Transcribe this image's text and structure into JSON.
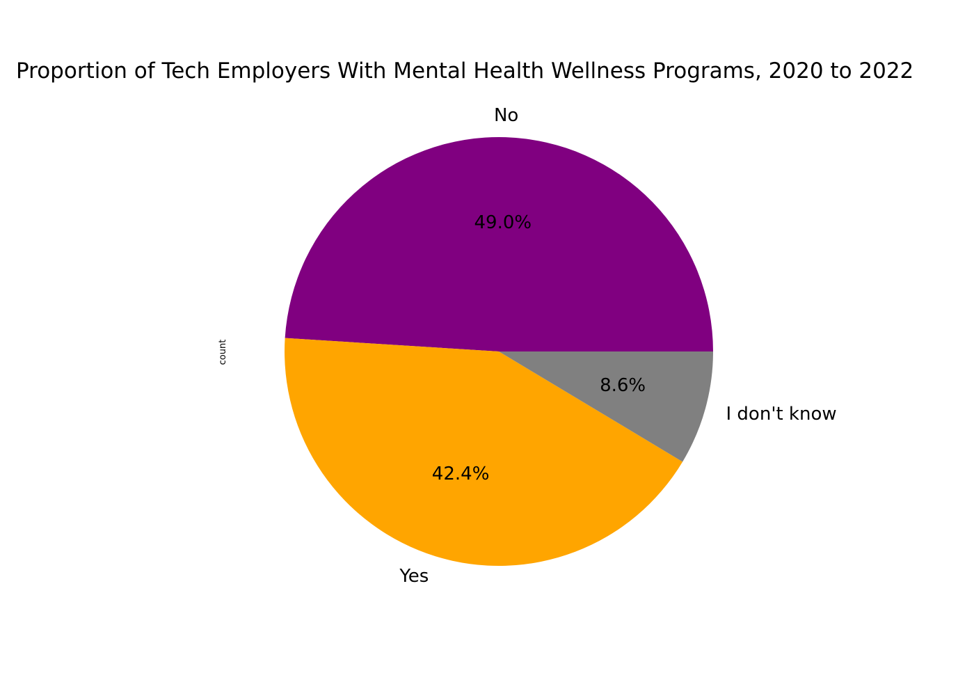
{
  "chart_data": {
    "type": "pie",
    "title": "Proportion of Tech Employers With Mental Health Wellness Programs, 2020 to 2022",
    "ylabel": "count",
    "start_angle_deg": 0,
    "direction": "counterclockwise",
    "slices": [
      {
        "label": "No",
        "percent": 49.0,
        "percent_label": "49.0%",
        "color": "#800080"
      },
      {
        "label": "Yes",
        "percent": 42.4,
        "percent_label": "42.4%",
        "color": "#FFA500"
      },
      {
        "label": "I don't know",
        "percent": 8.6,
        "percent_label": "8.6%",
        "color": "#808080"
      }
    ]
  }
}
